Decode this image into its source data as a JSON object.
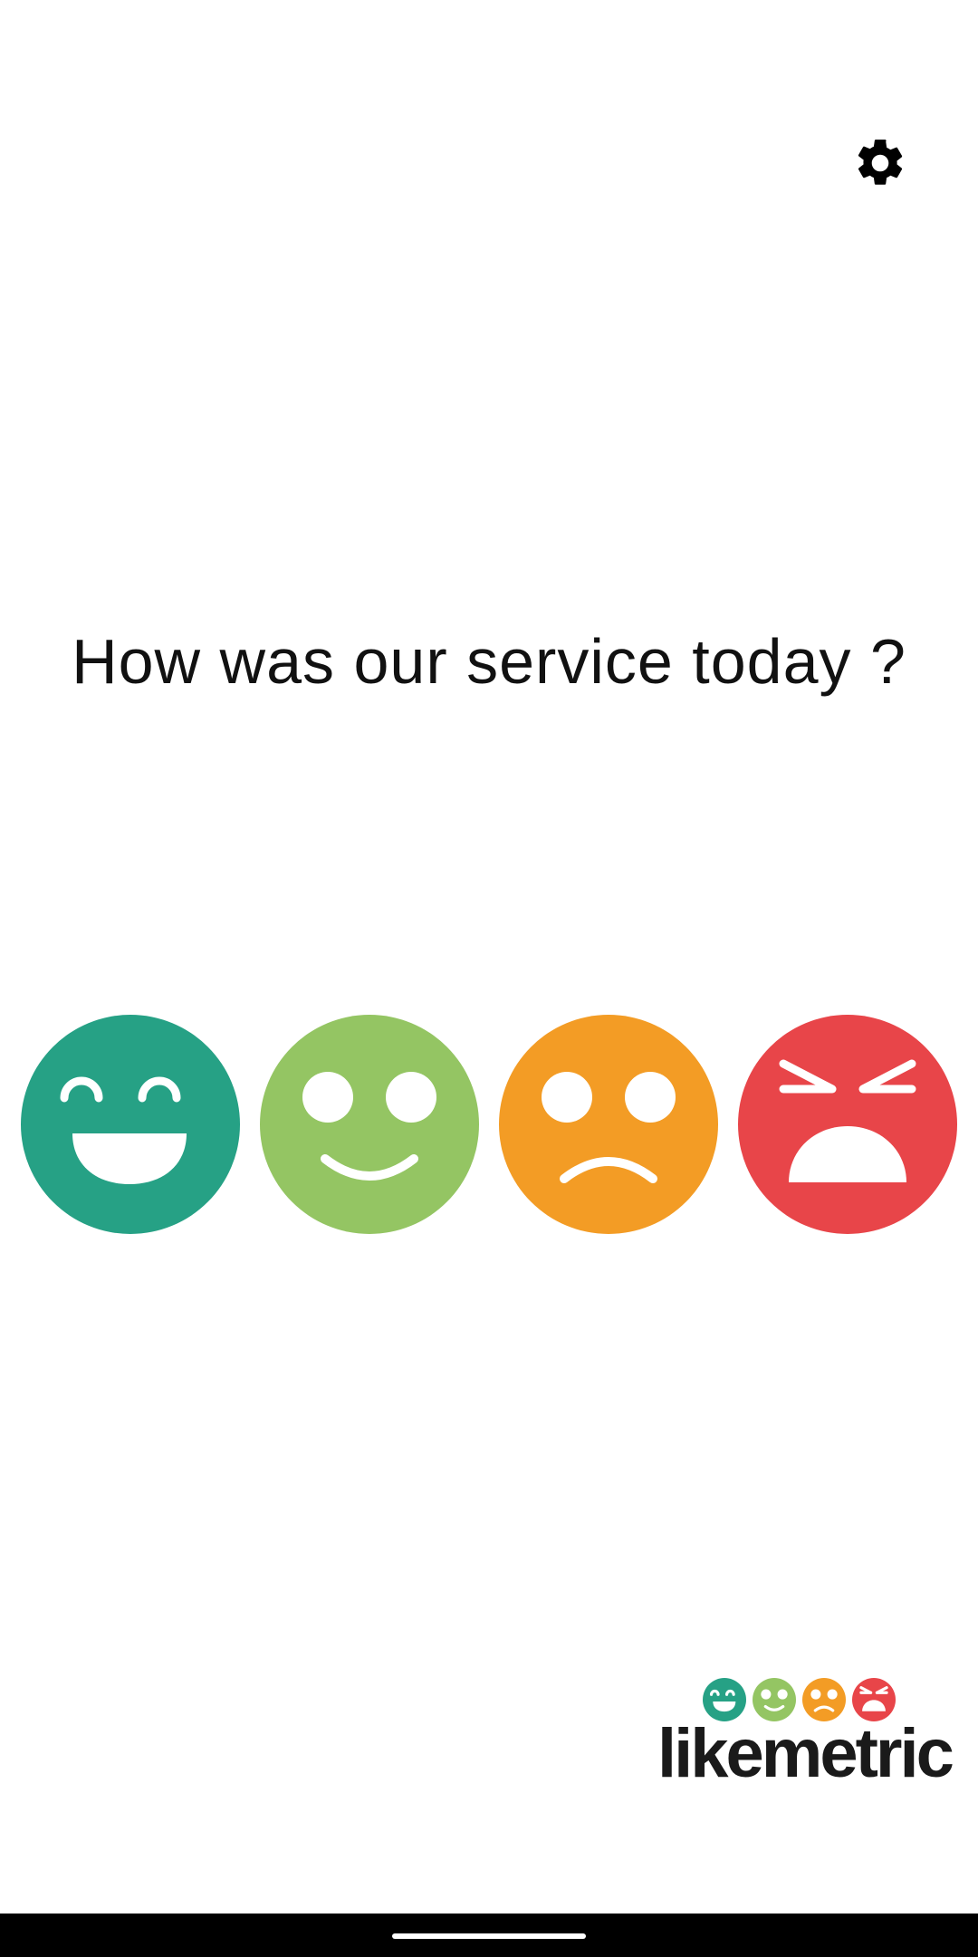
{
  "header": {
    "settings_icon": "gear-icon"
  },
  "question": {
    "text": "How was our service today ?"
  },
  "rating_options": [
    {
      "sentiment": "very-happy",
      "color": "#26a185",
      "icon": "grinning-face-icon"
    },
    {
      "sentiment": "happy",
      "color": "#94c563",
      "icon": "smiling-face-icon"
    },
    {
      "sentiment": "unhappy",
      "color": "#f39c25",
      "icon": "frowning-face-icon"
    },
    {
      "sentiment": "very-unhappy",
      "color": "#e84549",
      "icon": "angry-face-icon"
    }
  ],
  "branding": {
    "logo_text": "likemetric"
  },
  "system": {
    "nav_handle": "gesture-handle"
  }
}
